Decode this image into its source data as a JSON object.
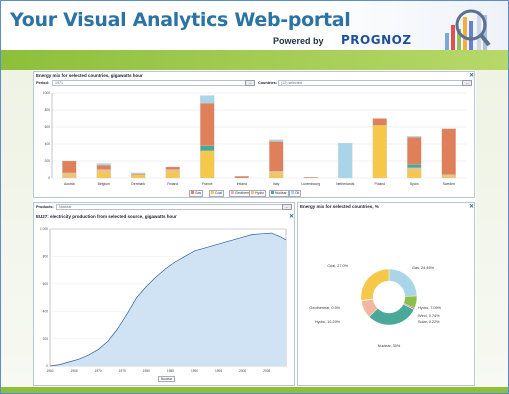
{
  "header": {
    "title": "Your Visual Analytics Web-portal",
    "powered_by": "Powered by",
    "brand": "PROGNOZ"
  },
  "panel1": {
    "title": "Energy mix for selected countries, gigawatts hour",
    "period_label": "Period:",
    "period_value": "1971",
    "countries_label": "Countries:",
    "countries_value": "(12) selected",
    "button_label": "...",
    "close": "✕"
  },
  "panel2": {
    "filter_label": "Products:",
    "filter_value": "Nuclear",
    "title": "EU27: electricity production from selected source, gigawatts hour",
    "legend": "Nuclear",
    "close": "✕"
  },
  "panel3": {
    "title": "Energy mix for selected countries, %",
    "close": "✕"
  },
  "colors": {
    "accent_green": "#8dbf3a",
    "title_blue": "#2c73a5",
    "coal": "#f5c84a",
    "gas": "#e0805a",
    "oil": "#a8d5e8",
    "nuclear": "#4aa89a",
    "hydro": "#f0c37a",
    "geothermal": "#f7a9c4"
  },
  "chart_data": [
    {
      "type": "bar",
      "title": "Energy mix for selected countries, gigawatts hour",
      "categories": [
        "Austria",
        "Belgium",
        "Denmark",
        "Finland",
        "France",
        "Ireland",
        "Italy",
        "Luxembourg",
        "Netherlands",
        "Poland",
        "Spain",
        "Sweden"
      ],
      "ylim": [
        0,
        1000
      ],
      "yticks": [
        "0",
        "200",
        "400",
        "600",
        "800",
        "1000"
      ],
      "series": [
        {
          "name": "Coal",
          "values": [
            0,
            60,
            40,
            60,
            320,
            0,
            40,
            0,
            0,
            620,
            80,
            0
          ]
        },
        {
          "name": "Geothermal",
          "values": [
            0,
            0,
            0,
            0,
            0,
            0,
            0,
            0,
            0,
            0,
            0,
            0
          ]
        },
        {
          "name": "Hydro",
          "values": [
            60,
            40,
            0,
            40,
            0,
            0,
            40,
            0,
            0,
            0,
            40,
            40
          ]
        },
        {
          "name": "Nuclear",
          "values": [
            0,
            0,
            0,
            0,
            60,
            0,
            0,
            0,
            0,
            0,
            40,
            0
          ]
        },
        {
          "name": "Gas",
          "values": [
            140,
            50,
            10,
            30,
            500,
            20,
            350,
            10,
            0,
            80,
            320,
            540
          ]
        },
        {
          "name": "Oil",
          "values": [
            0,
            20,
            10,
            0,
            90,
            0,
            20,
            0,
            410,
            0,
            10,
            0
          ]
        }
      ],
      "legend": [
        "Gas",
        "Coal",
        "Geothermal",
        "Hydro",
        "Nuclear",
        "Oil"
      ]
    },
    {
      "type": "area",
      "title": "EU27: electricity production from selected source, gigawatts hour",
      "x": [
        1960,
        1962,
        1964,
        1966,
        1968,
        1970,
        1972,
        1974,
        1976,
        1978,
        1980,
        1982,
        1984,
        1986,
        1988,
        1990,
        1992,
        1994,
        1996,
        1998,
        2000,
        2002,
        2004,
        2006,
        2008,
        2009
      ],
      "values": [
        0,
        10,
        30,
        50,
        80,
        120,
        180,
        270,
        380,
        500,
        580,
        650,
        710,
        760,
        800,
        840,
        860,
        880,
        900,
        920,
        940,
        960,
        965,
        970,
        940,
        920
      ],
      "xticks": [
        "1960",
        "1965",
        "1970",
        "1975",
        "1980",
        "1985",
        "1990",
        "1995",
        "2000",
        "2005"
      ],
      "yticks": [
        "0",
        "200",
        "400",
        "600",
        "800",
        "1 000"
      ],
      "ylim": [
        0,
        1000
      ],
      "series_name": "Nuclear"
    },
    {
      "type": "pie",
      "title": "Energy mix for selected countries, %",
      "slices": [
        {
          "label": "Gas, 24.46%",
          "value": 24.46
        },
        {
          "label": "Hydro, 7.09%",
          "value": 7.09
        },
        {
          "label": "Wind, 0.74%",
          "value": 0.74
        },
        {
          "label": "Solar, 0.22%",
          "value": 0.22
        },
        {
          "label": "Nuclear, 30%",
          "value": 30
        },
        {
          "label": "Hydro, 10.29%",
          "value": 10.29
        },
        {
          "label": "Geothermal, 0.3%",
          "value": 0.3
        },
        {
          "label": "Coal, 27.0%",
          "value": 27.0
        }
      ]
    }
  ]
}
